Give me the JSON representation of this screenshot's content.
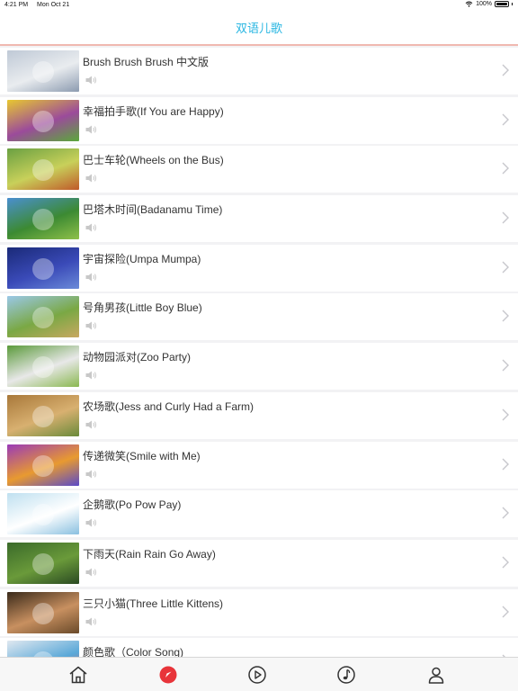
{
  "status": {
    "time": "4:21 PM",
    "date": "Mon Oct 21",
    "battery": "100%",
    "battery_level": 1.0
  },
  "header": {
    "title": "双语儿歌"
  },
  "songs": [
    {
      "title": "Brush Brush Brush 中文版",
      "thumb_colors": [
        "#bfc9d6",
        "#e9ecef",
        "#8c9bb0"
      ]
    },
    {
      "title": "幸福拍手歌(If You are Happy)",
      "thumb_colors": [
        "#e8c830",
        "#9b4b9b",
        "#5aa83a"
      ]
    },
    {
      "title": "巴士车轮(Wheels on the Bus)",
      "thumb_colors": [
        "#6aa042",
        "#c8d05a",
        "#c05a2a"
      ]
    },
    {
      "title": "巴塔木时间(Badanamu Time)",
      "thumb_colors": [
        "#4a8fd0",
        "#3c8a32",
        "#8fc04a"
      ]
    },
    {
      "title": "宇宙探险(Umpa Mumpa)",
      "thumb_colors": [
        "#1a2a78",
        "#3a4ab8",
        "#6a8ad8"
      ]
    },
    {
      "title": "号角男孩(Little Boy Blue)",
      "thumb_colors": [
        "#9ac8e8",
        "#7aa844",
        "#c8a860"
      ]
    },
    {
      "title": "动物园派对(Zoo Party)",
      "thumb_colors": [
        "#5a9a3a",
        "#e8e8e8",
        "#8ab850"
      ]
    },
    {
      "title": "农场歌(Jess and Curly Had a Farm)",
      "thumb_colors": [
        "#a8783a",
        "#d8b070",
        "#6a8a3a"
      ]
    },
    {
      "title": "传递微笑(Smile with Me)",
      "thumb_colors": [
        "#9a3ab8",
        "#e89a30",
        "#5a4ac8"
      ]
    },
    {
      "title": "企鹅歌(Po Pow Pay)",
      "thumb_colors": [
        "#bfe0f0",
        "#ffffff",
        "#8ac0e0"
      ]
    },
    {
      "title": "下雨天(Rain Rain Go Away)",
      "thumb_colors": [
        "#3a6a2a",
        "#6a9a3a",
        "#2a4a22"
      ]
    },
    {
      "title": "三只小猫(Three Little Kittens)",
      "thumb_colors": [
        "#3a2a1a",
        "#c89060",
        "#6a4a2a"
      ]
    },
    {
      "title": "颜色歌（Color Song)",
      "thumb_colors": [
        "#e0e8f0",
        "#5aa8d8",
        "#e85a5a"
      ]
    }
  ],
  "tabs": [
    {
      "name": "home",
      "icon": "home-icon",
      "selected": false
    },
    {
      "name": "discover",
      "icon": "compass-icon",
      "selected": true
    },
    {
      "name": "video",
      "icon": "play-icon",
      "selected": false
    },
    {
      "name": "music",
      "icon": "music-note-icon",
      "selected": false
    },
    {
      "name": "profile",
      "icon": "person-icon",
      "selected": false
    }
  ],
  "colors": {
    "accent": "#2bb7e2",
    "selected_tab": "#e8343a",
    "tab_icon": "#333333",
    "header_underline": "#f0b8b0",
    "chevron": "#c7c7cc",
    "speaker": "#c8c8c8"
  }
}
